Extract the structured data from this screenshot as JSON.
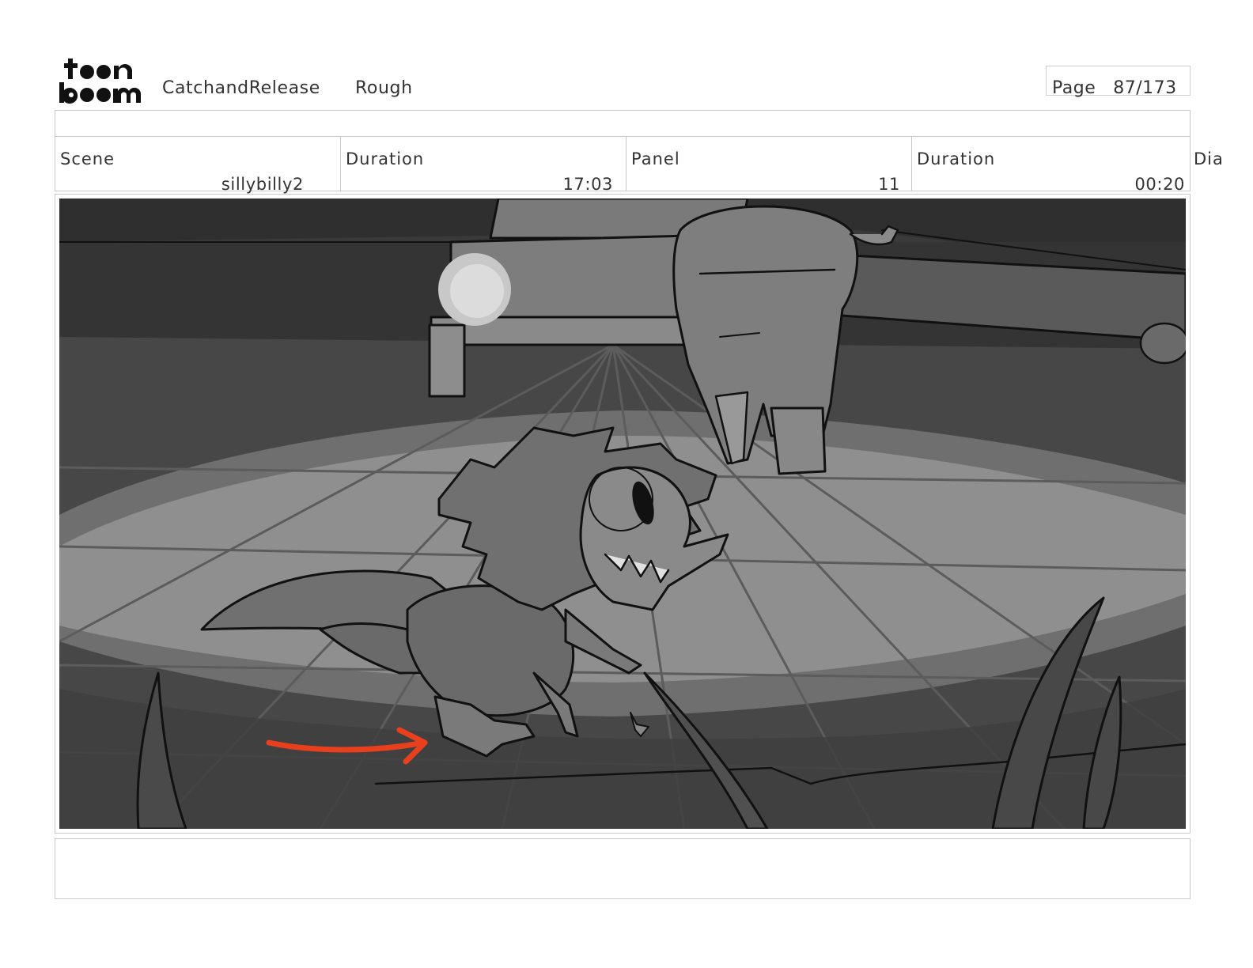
{
  "header": {
    "logo_text": "toon boom",
    "project": "CatchandRelease",
    "stage": "Rough",
    "page_label": "Page",
    "page_number": "87/173"
  },
  "info": {
    "scene_label": "Scene",
    "scene_value": "sillybilly2",
    "scene_duration_label": "Duration",
    "scene_duration_value": "17:03",
    "panel_label": "Panel",
    "panel_value": "11",
    "panel_duration_label": "Duration",
    "panel_duration_value": "00:20",
    "dialogue_label": "Dia"
  },
  "panel": {
    "arrow_color": "#e8401c"
  },
  "notes": {
    "text": ""
  }
}
